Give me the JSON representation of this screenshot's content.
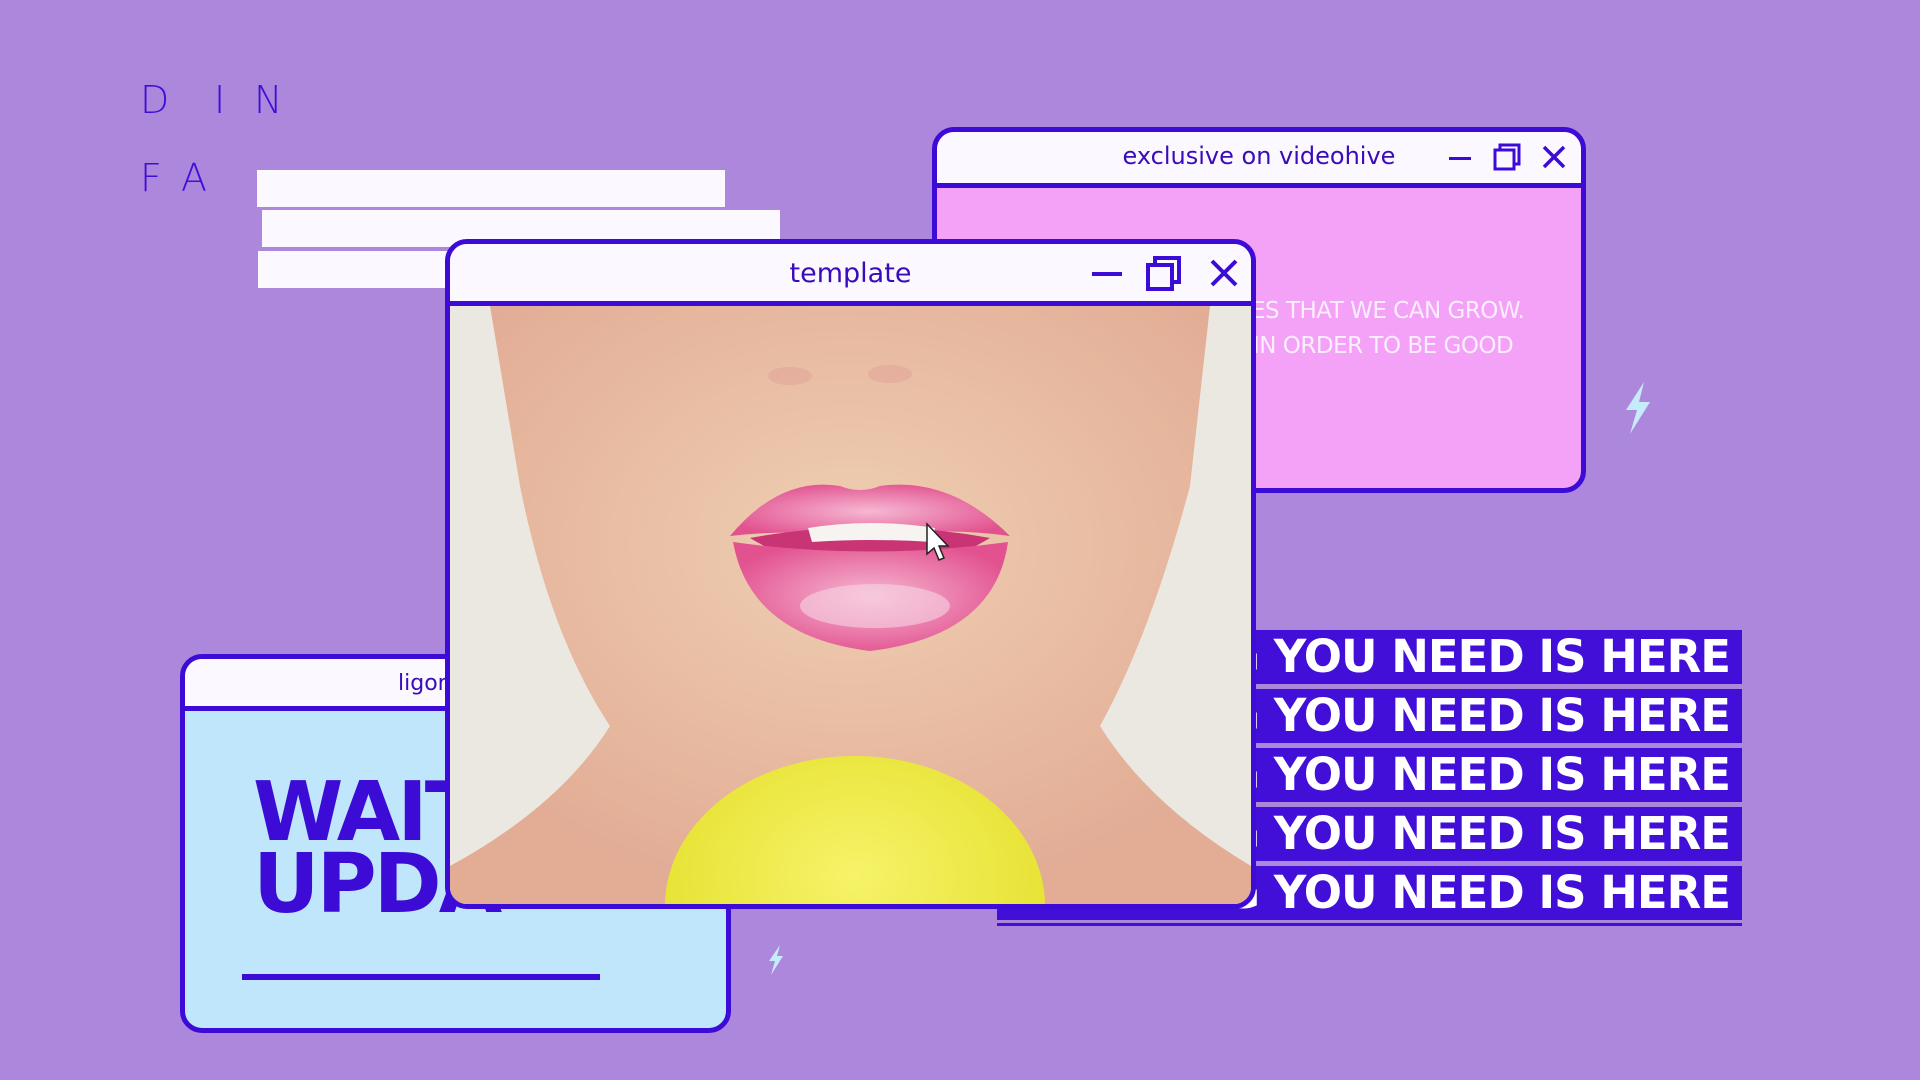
{
  "kinetic_letters": {
    "row1": [
      "D",
      "I",
      "N"
    ],
    "row2": [
      "F",
      "A"
    ]
  },
  "windows": {
    "videohive": {
      "title": "exclusive on videohive",
      "body_lines": [
        "ES THAT WE CAN GROW.",
        "IN ORDER TO BE GOOD"
      ],
      "body_color": "#f3a2f7"
    },
    "template": {
      "title": "template",
      "content": "video-frame: woman with pink glossy lips holding a yellow lollipop"
    },
    "ligon": {
      "title": "ligon",
      "headline_lines": [
        "WAIT",
        "UPDA"
      ],
      "body_color": "#bfe6fb"
    }
  },
  "banner": {
    "lines": [
      "IG YOU NEED IS HERE",
      "IG YOU NEED IS HERE",
      "IG YOU NEED IS HERE",
      "IG YOU NEED IS HERE",
      "NG YOU NEED IS HERE"
    ]
  },
  "icons": {
    "minimize": "minimize-icon",
    "maximize": "restore-icon",
    "close": "close-icon",
    "bolt": "lightning-bolt-icon",
    "cursor": "mouse-pointer-icon"
  },
  "colors": {
    "background": "#ad87db",
    "accent": "#3d0bd6",
    "titlebar": "#fbf8ff",
    "bolt": "#c6ecfb"
  }
}
